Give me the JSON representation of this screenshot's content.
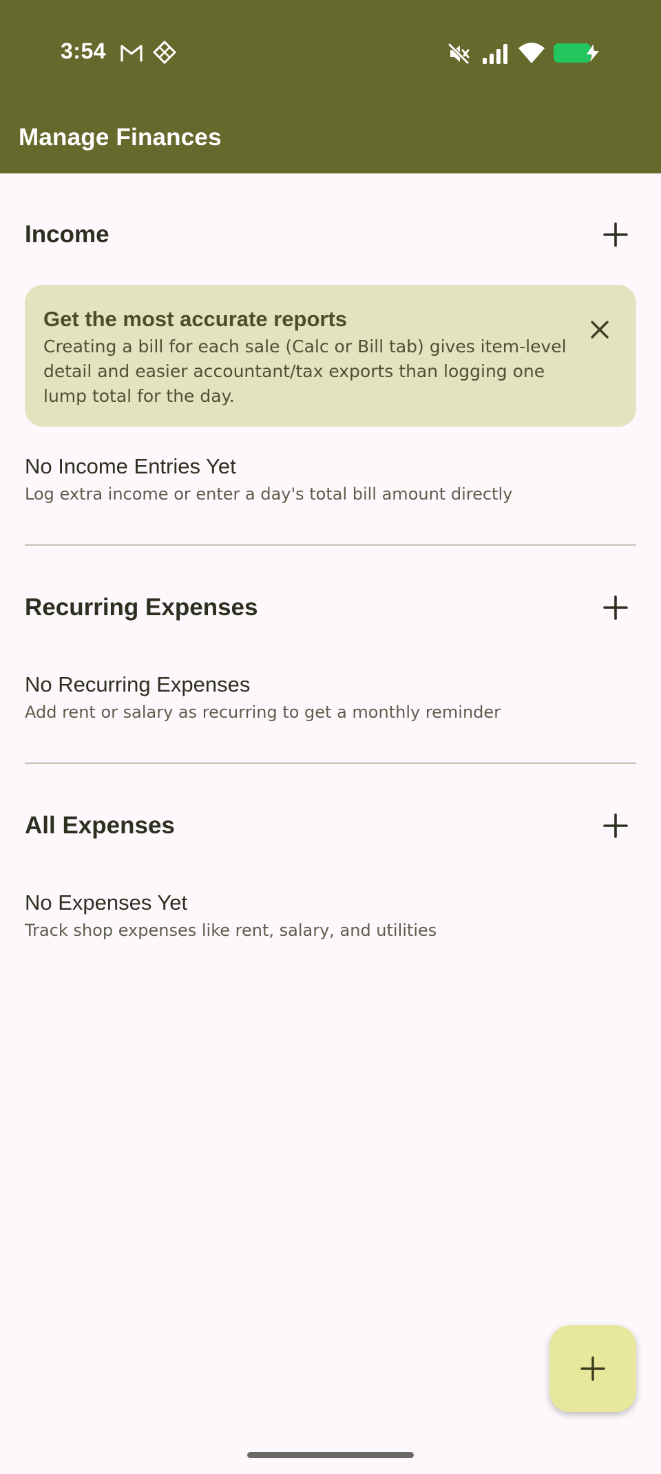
{
  "status_bar": {
    "time": "3:54",
    "left_icons": [
      "gmail-icon",
      "diamond-grid-icon"
    ],
    "right_icons": [
      "mute-icon",
      "signal-icon",
      "wifi-icon",
      "battery-charging-icon"
    ],
    "battery_color": "#22c55e"
  },
  "app_bar": {
    "title": "Manage Finances",
    "color": "#66692c"
  },
  "income": {
    "title": "Income",
    "add_icon": "plus-icon",
    "tip": {
      "title": "Get the most accurate reports",
      "body": "Creating a bill for each sale (Calc or Bill tab) gives item-level detail and easier accountant/tax exports than logging one lump total for the day.",
      "close_icon": "close-icon"
    },
    "empty_title": "No Income Entries Yet",
    "empty_subtitle": "Log extra income or enter a day's total bill amount directly"
  },
  "recurring": {
    "title": "Recurring Expenses",
    "add_icon": "plus-icon",
    "empty_title": "No Recurring Expenses",
    "empty_subtitle": "Add rent or salary as recurring to get a monthly reminder"
  },
  "expenses": {
    "title": "All Expenses",
    "add_icon": "plus-icon",
    "empty_title": "No Expenses Yet",
    "empty_subtitle": "Track shop expenses like rent, salary, and utilities"
  },
  "fab": {
    "icon": "plus-icon",
    "color": "#e8e89c"
  }
}
